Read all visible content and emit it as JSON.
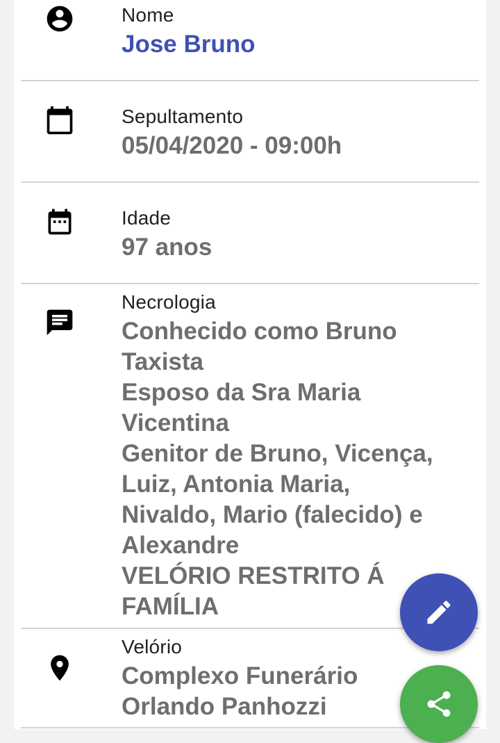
{
  "fields": {
    "nome": {
      "label": "Nome",
      "value": "Jose Bruno",
      "icon": "account-circle-icon"
    },
    "sepultamento": {
      "label": "Sepultamento",
      "value": "05/04/2020 - 09:00h",
      "icon": "calendar-icon"
    },
    "idade": {
      "label": "Idade",
      "value": "97 anos",
      "icon": "calendar-dots-icon"
    },
    "necrologia": {
      "label": "Necrologia",
      "icon": "message-icon",
      "lines": [
        "Conhecido como Bruno",
        "Taxista",
        "Esposo da Sra Maria",
        "Vicentina",
        "Genitor de Bruno, Vicença,",
        "Luiz, Antonia Maria,",
        "Nivaldo, Mario (falecido) e",
        "Alexandre",
        "VELÓRIO RESTRITO Á",
        "FAMÍLIA"
      ]
    },
    "velorio": {
      "label": "Velório",
      "icon": "location-pin-icon",
      "lines": [
        "Complexo Funerário",
        "Orlando Panhozzi"
      ]
    }
  },
  "fabs": {
    "edit": {
      "icon": "pencil-icon",
      "color": "#3f51b5"
    },
    "share": {
      "icon": "share-icon",
      "color": "#4caf50"
    }
  },
  "colors": {
    "name_accent": "#3f51b5",
    "value_text": "#6e6e6e"
  }
}
